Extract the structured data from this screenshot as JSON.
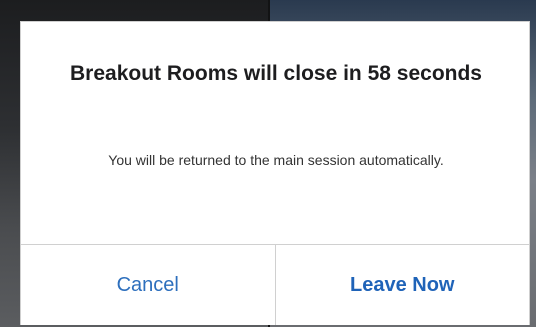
{
  "dialog": {
    "title": "Breakout Rooms will close in 58 seconds",
    "message": "You will be returned to the main session automatically.",
    "buttons": {
      "cancel_label": "Cancel",
      "leave_now_label": "Leave Now"
    }
  },
  "colors": {
    "dialog_background": "#ffffff",
    "button_text": "#2d6fbd",
    "divider": "#d0d0d0",
    "title_text": "#1d1d1f"
  }
}
